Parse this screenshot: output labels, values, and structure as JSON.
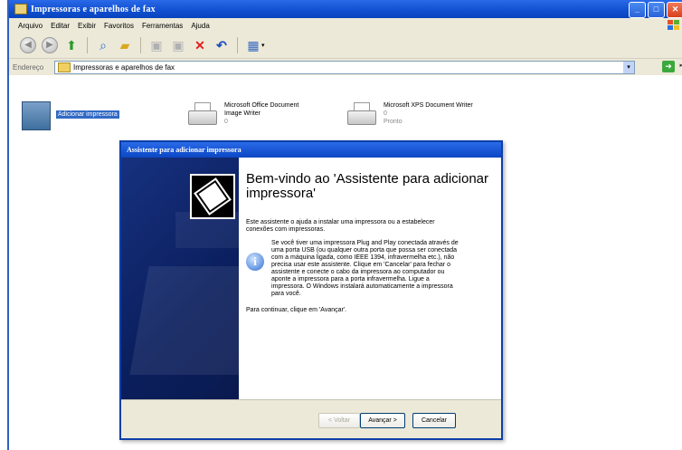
{
  "window": {
    "title": "Impressoras e aparelhos de fax"
  },
  "menu": [
    "Arquivo",
    "Editar",
    "Exibir",
    "Favoritos",
    "Ferramentas",
    "Ajuda"
  ],
  "address": {
    "label": "Endereço",
    "value": "Impressoras e aparelhos de fax"
  },
  "printers": [
    {
      "name": "Adicionar impressora"
    },
    {
      "name": "Microsoft Office Document Image Writer",
      "line1": "Microsoft Office Document",
      "line2": "Image Writer",
      "count": "0"
    },
    {
      "name": "Microsoft XPS Document Writer",
      "line1": "Microsoft XPS Document Writer",
      "count": "0",
      "status": "Pronto"
    }
  ],
  "wizard": {
    "title": "Assistente para adicionar impressora",
    "heading": "Bem-vindo ao 'Assistente para adicionar impressora'",
    "intro": "Este assistente o ajuda a instalar uma impressora ou a estabelecer conexões com impressoras.",
    "info": "Se você tiver uma impressora Plug and Play conectada através de uma porta USB (ou qualquer outra porta que possa ser conectada com a máquina ligada, como IEEE 1394, infravermelha etc.), não precisa usar este assistente. Clique em 'Cancelar' para fechar o assistente e conecte o cabo da impressora ao computador ou aponte a impressora para a porta infravermelha. Ligue a impressora. O Windows instalará automaticamente a impressora para você.",
    "continue": "Para continuar, clique em 'Avançar'.",
    "buttons": {
      "back": "< Voltar",
      "next": "Avançar >",
      "cancel": "Cancelar"
    }
  },
  "colors": {
    "titlebar": "#0f4fd0",
    "wizard_side": "#0b1f5e",
    "selection": "#316ac5",
    "chrome": "#ece9d8"
  }
}
